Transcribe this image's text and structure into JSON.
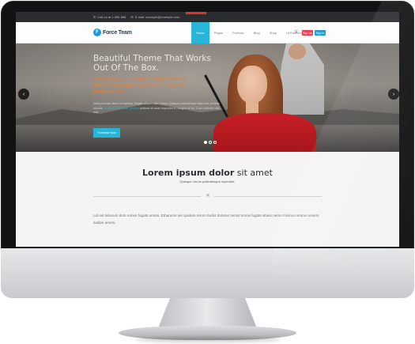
{
  "topbar": {
    "phone_icon": "phone-icon",
    "phone": "Call us at 1-555-888",
    "email_icon": "envelope-icon",
    "email": "E-mail: example@example.com"
  },
  "logo": {
    "text": "Force Team",
    "mark": "F"
  },
  "nav": [
    {
      "label": "Home",
      "active": true
    },
    {
      "label": "Pages"
    },
    {
      "label": "Portfolio"
    },
    {
      "label": "Blog"
    },
    {
      "label": "Shop"
    },
    {
      "label": "UI Elements"
    }
  ],
  "header_buttons": {
    "search_icon": "search-icon",
    "signup": "Sign Up",
    "signin": "Sign In"
  },
  "hero": {
    "title": "Beautiful Theme That Works Out Of The Box.",
    "subtitle": "Force Team is a beautiful Wrapbootstrap theme for design agencies and creative professionals.",
    "body_before": "Nulla pulvinar, libero id dapibus, fringilla aliquet nibh. Donec Quisque pellentesque diam sed pulvinar lobortis.",
    "body_link": "Aliquam ante tellus, pretium",
    "body_after": "pulvinar sit amet imperdiet in, congue at leo. Cras molestie velit erat.",
    "button": "Purchase Now",
    "prev_icon": "chevron-left-icon",
    "next_icon": "chevron-right-icon"
  },
  "section": {
    "title_bold": "Lorem ipsum dolor",
    "title_rest": " sit amet",
    "subtitle": "Quisque rutrum pellentesque imperdiet.",
    "divider_icon": "star-icon",
    "paragraph": "Lid est laborum dolo rumes fugats untras. Etharums ser quidem rerum facilis dolores nemis omnis fugats vitaes nemo minima rerums unsers sadips amets."
  }
}
